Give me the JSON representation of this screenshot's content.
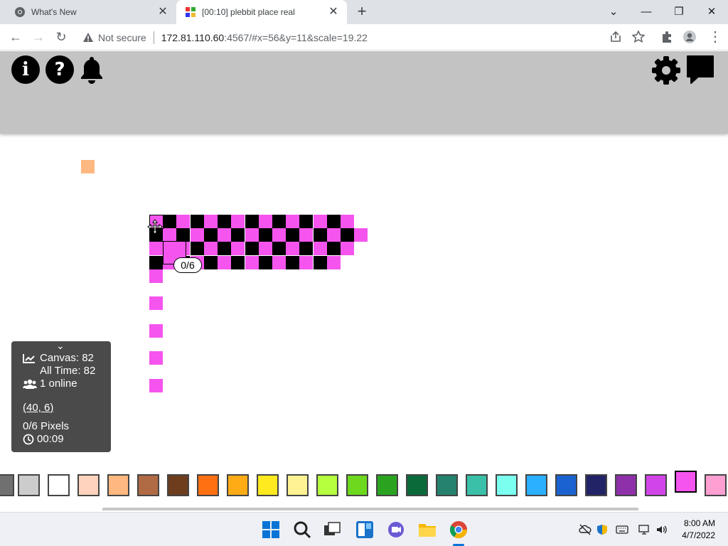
{
  "browser": {
    "tabs": [
      {
        "title": "What's New",
        "active": false
      },
      {
        "title": "[00:10] plebbit place real",
        "active": true
      }
    ],
    "security_label": "Not secure",
    "url_host": "172.81.110.60",
    "url_rest": ":4567/#x=56&y=11&scale=19.22"
  },
  "page": {
    "toolbar_left_icons": [
      "info-icon",
      "help-icon",
      "bell-icon"
    ],
    "toolbar_right_icons": [
      "gear-icon",
      "chat-icon"
    ],
    "selection_count": "0/6",
    "info_panel": {
      "canvas_label": "Canvas: 82",
      "alltime_label": "All Time: 82",
      "online_label": "1 online",
      "coords": "(40, 6)",
      "pixels_label": "0/6 Pixels",
      "timer": "00:09"
    },
    "palette": [
      "#707070",
      "#cccccc",
      "#ffffff",
      "#ffd3bd",
      "#ffb880",
      "#b06a44",
      "#6e3d1e",
      "#ff7012",
      "#ffab15",
      "#ffea1f",
      "#fff292",
      "#b5ff3f",
      "#6dd81e",
      "#2aa420",
      "#0a6a3a",
      "#24826e",
      "#3ac0a8",
      "#7bffef",
      "#2ab0ff",
      "#1a62d0",
      "#222266",
      "#8e30aa",
      "#d144e8",
      "#f555ee",
      "#ff9fd2"
    ],
    "selected_color": "#f555ee",
    "pixel_colors": {
      "magenta": "#f555ee",
      "black": "#000000",
      "orange": "#ffb880"
    }
  },
  "taskbar": {
    "time": "8:00 AM",
    "date": "4/7/2022"
  }
}
